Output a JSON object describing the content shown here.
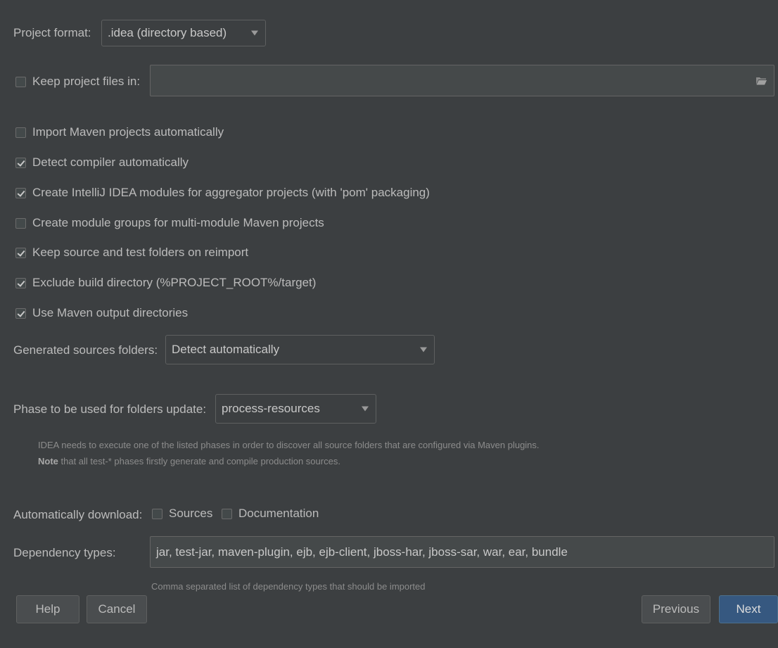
{
  "project_format": {
    "label": "Project format:",
    "value": ".idea (directory based)"
  },
  "keep_project_files": {
    "label": "Keep project files in:",
    "checked": false,
    "value": ""
  },
  "options": [
    {
      "label": "Import Maven projects automatically",
      "checked": false
    },
    {
      "label": "Detect compiler automatically",
      "checked": true
    },
    {
      "label": "Create IntelliJ IDEA modules for aggregator projects (with 'pom' packaging)",
      "checked": true
    },
    {
      "label": "Create module groups for multi-module Maven projects",
      "checked": false
    },
    {
      "label": "Keep source and test folders on reimport",
      "checked": true
    },
    {
      "label": "Exclude build directory (%PROJECT_ROOT%/target)",
      "checked": true
    },
    {
      "label": "Use Maven output directories",
      "checked": true
    }
  ],
  "generated_sources": {
    "label": "Generated sources folders:",
    "value": "Detect automatically"
  },
  "phase": {
    "label": "Phase to be used for folders update:",
    "value": "process-resources",
    "hint_line1": "IDEA needs to execute one of the listed phases in order to discover all source folders that are configured via Maven plugins.",
    "hint_line2_bold": "Note",
    "hint_line2_rest": " that all test-* phases firstly generate and compile production sources."
  },
  "auto_download": {
    "label": "Automatically download:",
    "sources_label": "Sources",
    "sources_checked": false,
    "documentation_label": "Documentation",
    "documentation_checked": false
  },
  "dependency_types": {
    "label": "Dependency types:",
    "value": "jar, test-jar, maven-plugin, ejb, ejb-client, jboss-har, jboss-sar, war, ear, bundle",
    "hint": "Comma separated list of dependency types that should be imported"
  },
  "buttons": {
    "help": "Help",
    "cancel": "Cancel",
    "previous": "Previous",
    "next": "Next"
  },
  "colors": {
    "background": "#3c3f41",
    "primary_button": "#365880"
  },
  "icons": {
    "folder": "folder-icon",
    "dropdown": "chevron-down-icon"
  }
}
